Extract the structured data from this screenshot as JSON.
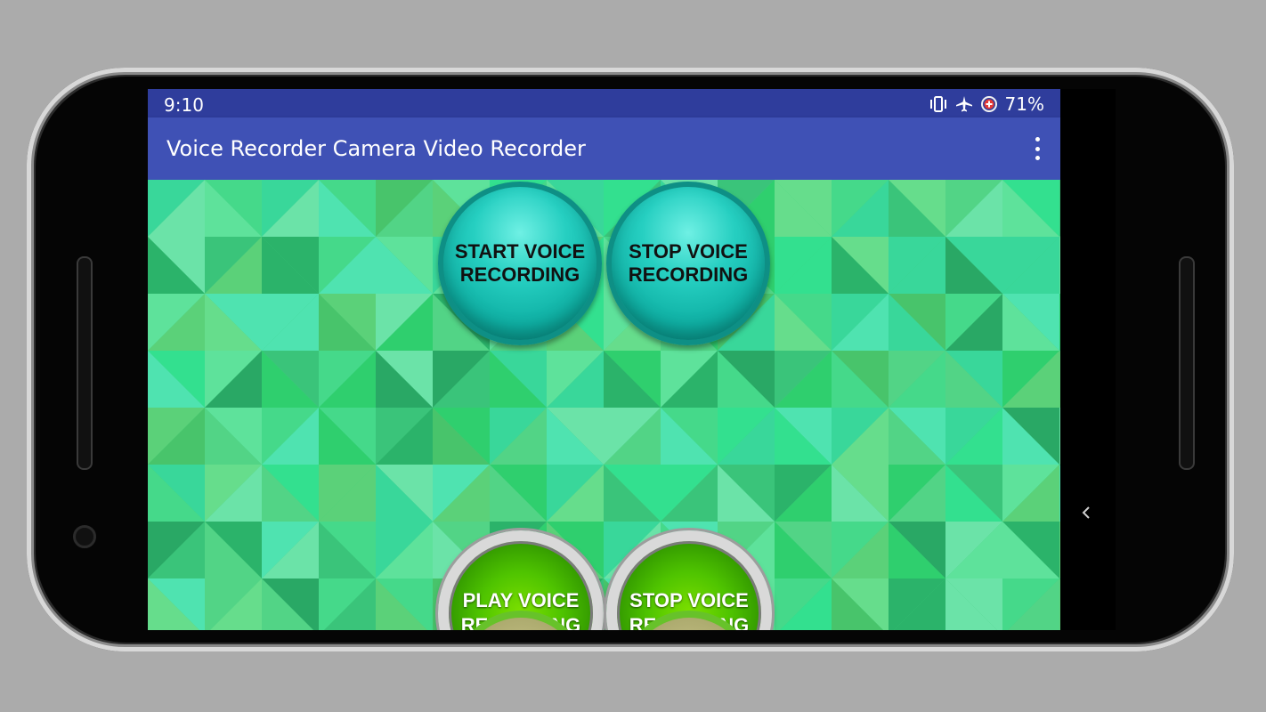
{
  "status_bar": {
    "time": "9:10",
    "battery": "71%",
    "icons": [
      "vibrate-icon",
      "airplane-mode-icon",
      "data-saver-icon"
    ]
  },
  "app_bar": {
    "title": "Voice Recorder Camera Video Recorder",
    "menu_icon": "overflow-menu-icon"
  },
  "buttons": {
    "start_voice": "START VOICE RECORDING",
    "stop_voice_top": "STOP VOICE RECORDING",
    "play_voice": "PLAY VOICE RECORDING",
    "stop_voice_bottom": "STOP VOICE RECORDING"
  },
  "colors": {
    "status_bar": "#2f3d9c",
    "app_bar": "#3f51b5",
    "teal_button": "#0fb0a4",
    "green_button": "#4fc400",
    "background_green": "#3fce7e"
  },
  "nav": {
    "back_icon": "back-chevron-icon"
  }
}
